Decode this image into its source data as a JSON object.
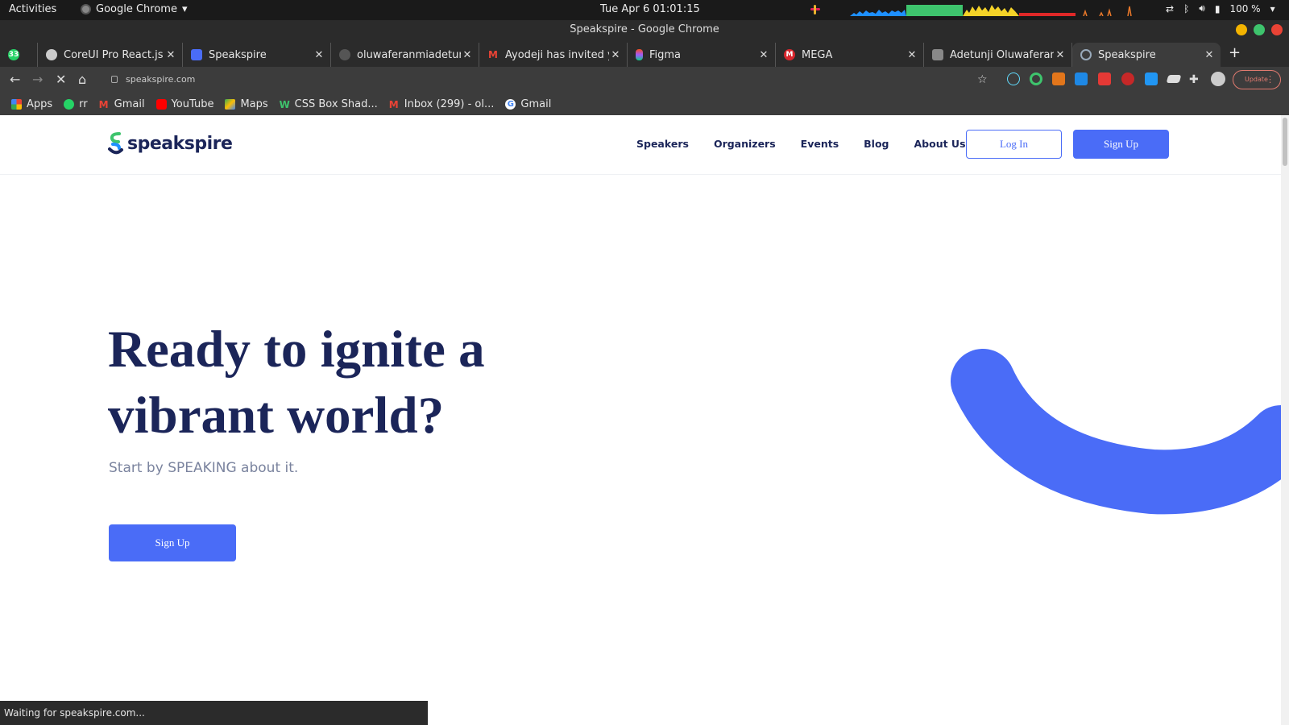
{
  "os": {
    "activities": "Activities",
    "app_name": "Google Chrome",
    "clock": "Tue Apr 6  01:01:15",
    "battery": "100 %"
  },
  "window": {
    "title": "Speakspire - Google Chrome"
  },
  "tabs": [
    {
      "title": "CoreUI Pro React.js",
      "icon": "coreui-icon"
    },
    {
      "title": "Speakspire",
      "icon": "speakspire-icon"
    },
    {
      "title": "oluwaferanmiadetunji",
      "icon": "github-icon"
    },
    {
      "title": "Ayodeji has invited you",
      "icon": "gmail-icon"
    },
    {
      "title": "Figma",
      "icon": "figma-icon"
    },
    {
      "title": "MEGA",
      "icon": "mega-icon"
    },
    {
      "title": "Adetunji Oluwaferanmi",
      "icon": "profile-icon"
    },
    {
      "title": "Speakspire",
      "icon": "speakspire-icon"
    }
  ],
  "toolbar": {
    "url": "speakspire.com",
    "update_label": "Update"
  },
  "bookmarks": [
    {
      "label": "Apps"
    },
    {
      "label": "rr"
    },
    {
      "label": "Gmail"
    },
    {
      "label": "YouTube"
    },
    {
      "label": "Maps"
    },
    {
      "label": "CSS Box Shad..."
    },
    {
      "label": "Inbox (299) - ol..."
    },
    {
      "label": "Gmail"
    }
  ],
  "site": {
    "brand": "speakspire",
    "nav": [
      "Speakers",
      "Organizers",
      "Events",
      "Blog",
      "About Us"
    ],
    "login_label": "Log In",
    "signup_label": "Sign Up",
    "hero_title": "Ready to ignite a vibrant world?",
    "hero_subtitle": "Start by SPEAKING about it.",
    "hero_cta": "Sign Up",
    "accent": "#4a6cf7",
    "heading_color": "#1b2559"
  },
  "status_text": "Waiting for speakspire.com..."
}
